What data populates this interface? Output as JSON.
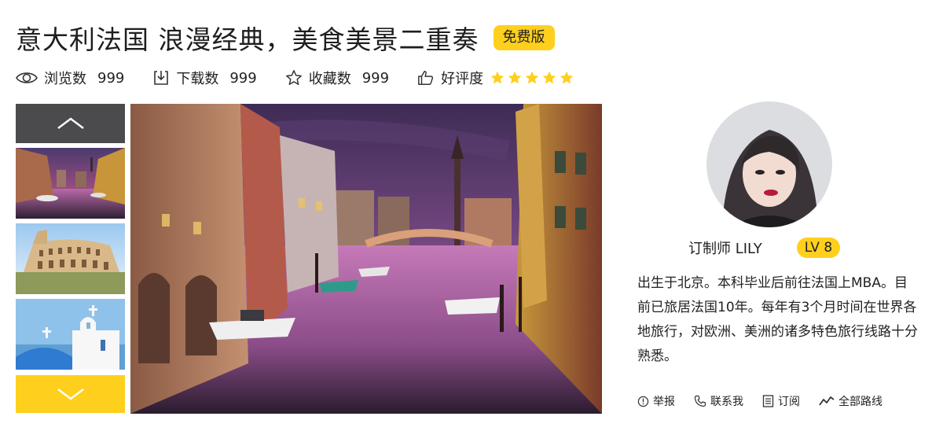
{
  "title": "意大利法国  浪漫经典，美食美景二重奏",
  "free_badge": "免费版",
  "stats": {
    "views_label": "浏览数",
    "views_value": "999",
    "downloads_label": "下载数",
    "downloads_value": "999",
    "favorites_label": "收藏数",
    "favorites_value": "999",
    "rating_label": "好评度",
    "rating_stars": 5,
    "icons": [
      "eye-icon",
      "download-icon",
      "star-outline-icon",
      "thumbs-up-icon"
    ]
  },
  "gallery": {
    "thumbnails": [
      "venice-canal-thumbnail",
      "colosseum-thumbnail",
      "santorini-church-thumbnail"
    ],
    "selected_index": 0
  },
  "planner": {
    "name": "订制师 LILY",
    "level": "LV 8",
    "bio": "出生于北京。本科毕业后前往法国上MBA。目前已旅居法国10年。每年有3个月时间在世界各地旅行，对欧洲、美洲的诸多特色旅行线路十分熟悉。"
  },
  "actions": {
    "report": "举报",
    "contact": "联系我",
    "subscribe": "订阅",
    "all_routes": "全部路线"
  },
  "colors": {
    "accent_yellow": "#ffcf1d",
    "nav_dark": "#4b4b4d",
    "text": "#222222"
  }
}
